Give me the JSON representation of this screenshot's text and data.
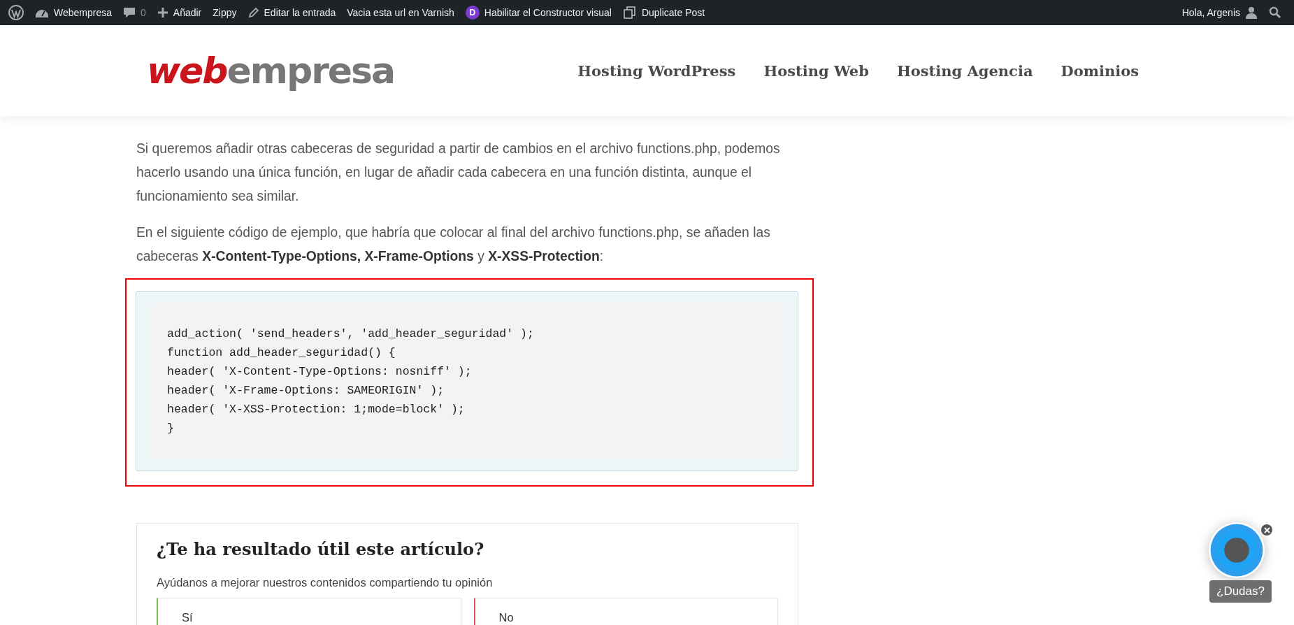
{
  "admin_bar": {
    "items": [
      {
        "kind": "wp"
      },
      {
        "kind": "site",
        "label": "Webempresa"
      },
      {
        "kind": "comments",
        "label": "0"
      },
      {
        "kind": "new",
        "label": "Añadir"
      },
      {
        "kind": "text",
        "label": "Zippy"
      },
      {
        "kind": "edit",
        "label": "Editar la entrada"
      },
      {
        "kind": "text",
        "label": "Vacia esta url en Varnish"
      },
      {
        "kind": "divi",
        "label": "Habilitar el Constructor visual",
        "badge": "D"
      },
      {
        "kind": "duplicate",
        "label": "Duplicate Post"
      }
    ],
    "greeting": "Hola, Argenis"
  },
  "header": {
    "logo_parts": [
      "web",
      "empresa"
    ],
    "nav": [
      "Hosting WordPress",
      "Hosting Web",
      "Hosting Agencia",
      "Dominios"
    ]
  },
  "article": {
    "paragraphs": [
      "Si queremos añadir otras cabeceras de seguridad a partir de cambios en el archivo functions.php, podemos hacerlo usando una única función, en lugar de añadir cada cabecera en una función distinta, aunque el funcionamiento sea similar.",
      "En el siguiente código de ejemplo, que habría que colocar al final del archivo functions.php, se añaden las cabeceras **X-Content-Type-Options, X-Frame-Options** y **X-XSS-Protection**:"
    ],
    "code": [
      "add_action( 'send_headers', 'add_header_seguridad' );",
      "function add_header_seguridad() {",
      "header( 'X-Content-Type-Options: nosniff' );",
      "header( 'X-Frame-Options: SAMEORIGIN' );",
      "header( 'X-XSS-Protection: 1;mode=block' );",
      "}"
    ]
  },
  "feedback": {
    "title": "¿Te ha resultado útil este artículo?",
    "subtitle": "Ayúdanos a mejorar nuestros contenidos compartiendo tu opinión",
    "options": [
      {
        "label": "Sí",
        "kind": "yes"
      },
      {
        "label": "No",
        "kind": "no"
      }
    ]
  },
  "chat": {
    "label": "¿Dudas?"
  }
}
